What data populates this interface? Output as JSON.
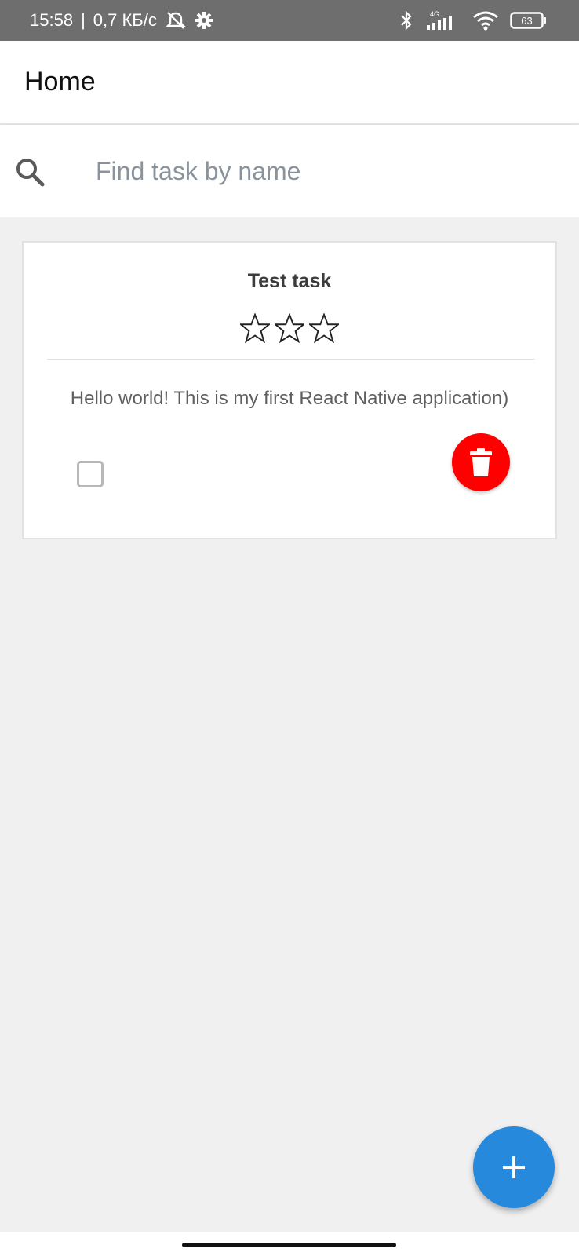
{
  "status_bar": {
    "time": "15:58",
    "separator": "|",
    "network_speed": "0,7 КБ/с",
    "network_type": "4G",
    "battery_level": "63",
    "icons": [
      "alarm-off-icon",
      "settings-icon",
      "bluetooth-icon",
      "signal-icon",
      "wifi-icon",
      "battery-icon"
    ]
  },
  "header": {
    "title": "Home"
  },
  "search": {
    "placeholder": "Find task by name",
    "value": ""
  },
  "tasks": [
    {
      "title": "Test task",
      "rating": 0,
      "rating_max": 3,
      "description": "Hello world! This is my first React Native application)",
      "completed": false
    }
  ],
  "colors": {
    "delete_button": "#ff0000",
    "fab": "#2789dc",
    "background": "#f0f0f0",
    "status_bar": "#6e6e6e"
  },
  "fab": {
    "icon": "plus-icon"
  }
}
